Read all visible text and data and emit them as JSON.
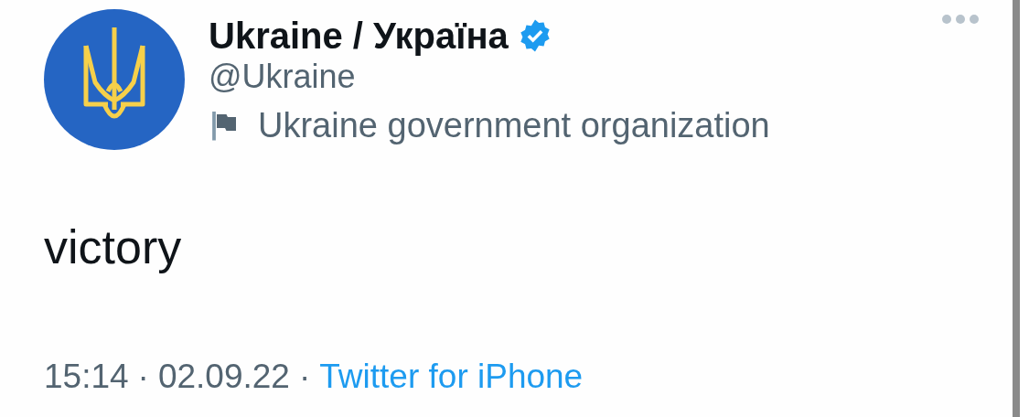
{
  "author": {
    "name": "Ukraine / Україна",
    "verified": true,
    "handle": "@Ukraine",
    "label": "Ukraine government organization"
  },
  "text": "victory",
  "footer": [
    {
      "kind": "time",
      "text": "15:14"
    },
    {
      "kind": "dot",
      "text": "·"
    },
    {
      "kind": "date",
      "text": "02.09.22"
    },
    {
      "kind": "dot",
      "text": "·"
    },
    {
      "kind": "link",
      "text": "Twitter for iPhone"
    }
  ]
}
